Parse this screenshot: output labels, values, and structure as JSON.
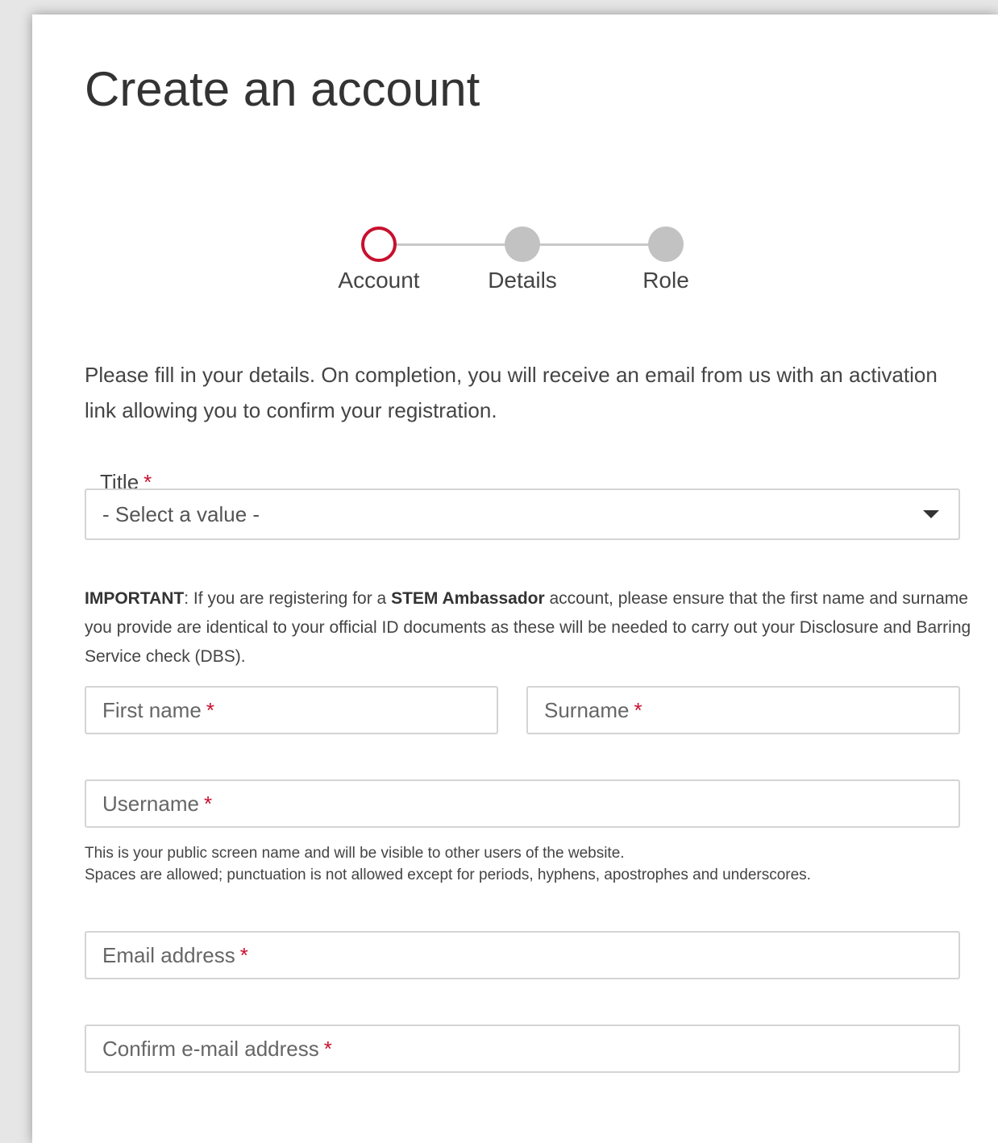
{
  "page": {
    "title": "Create an account"
  },
  "stepper": {
    "steps": [
      {
        "label": "Account",
        "state": "current"
      },
      {
        "label": "Details",
        "state": "pending"
      },
      {
        "label": "Role",
        "state": "pending"
      }
    ],
    "accent_color": "#c8102e",
    "pending_color": "#c2c2c2"
  },
  "intro": {
    "text": "Please fill in your details. On completion, you will receive an email from us with an activation link allowing you to confirm your registration."
  },
  "form": {
    "required_marker": "*",
    "title_field": {
      "label": "Title",
      "selected_value": "- Select a value -"
    },
    "notice": {
      "important": "IMPORTANT",
      "part1": ": If you are registering for a ",
      "bold": "STEM Ambassador",
      "part2": " account, please ensure that the first name and surname you provide are identical to your official ID documents as these will be needed to carry out your Disclosure and Barring Service check (DBS)."
    },
    "first_name": {
      "placeholder": "First name"
    },
    "surname": {
      "placeholder": "Surname"
    },
    "username": {
      "placeholder": "Username",
      "help_line1": "This is your public screen name and will be visible to other users of the website.",
      "help_line2": "Spaces are allowed; punctuation is not allowed except for periods, hyphens, apostrophes and underscores."
    },
    "email": {
      "placeholder": "Email address"
    },
    "confirm_email": {
      "placeholder": "Confirm e-mail address"
    }
  }
}
